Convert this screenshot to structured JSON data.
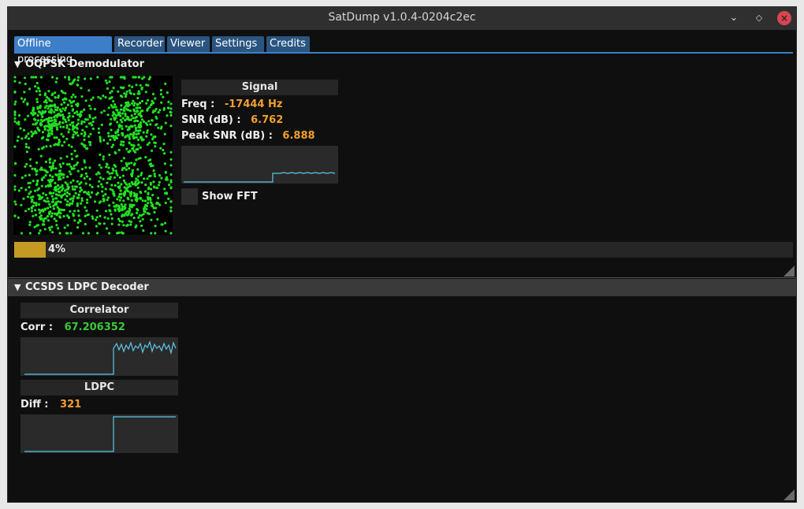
{
  "window": {
    "title": "SatDump v1.0.4-0204c2ec",
    "min_icon": "minimize-icon",
    "max_icon": "restore-icon",
    "close_icon": "close-icon"
  },
  "tabs": [
    {
      "label": "Offline processing",
      "active": true
    },
    {
      "label": "Recorder",
      "active": false
    },
    {
      "label": "Viewer",
      "active": false
    },
    {
      "label": "Settings",
      "active": false
    },
    {
      "label": "Credits",
      "active": false
    }
  ],
  "demod": {
    "header": "OQPSK Demodulator",
    "signal_title": "Signal",
    "freq_label": "Freq :",
    "freq_value": "-17444 Hz",
    "snr_label": "SNR (dB) :",
    "snr_value": "6.762",
    "peak_label": "Peak SNR (dB) :",
    "peak_value": "6.888",
    "show_fft_label": "Show FFT",
    "progress_text": "4%",
    "progress_fraction": 0.04
  },
  "decoder": {
    "header": "CCSDS LDPC Decoder",
    "correlator_title": "Correlator",
    "corr_label": "Corr  :",
    "corr_value": "67.206352",
    "ldpc_title": "LDPC",
    "diff_label": "Diff  :",
    "diff_value": "321"
  },
  "colors": {
    "accent": "#3d7ec8",
    "orange": "#f0a030",
    "green": "#3ac83a",
    "plot_line": "#5bc8e8",
    "constellation": "#22e022"
  }
}
